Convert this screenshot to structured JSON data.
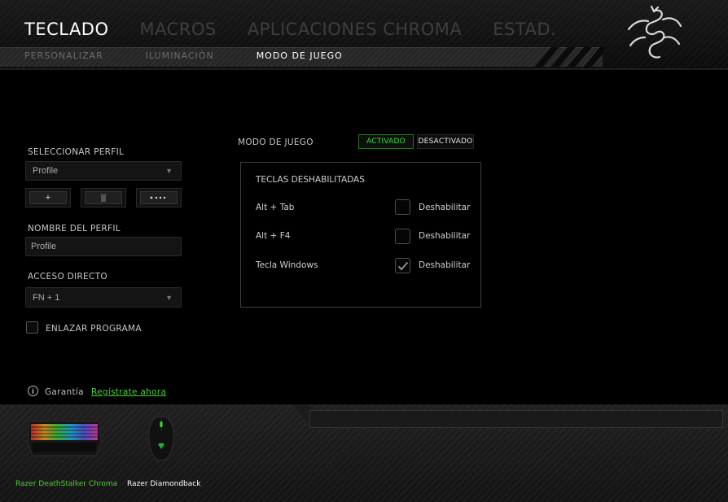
{
  "nav": {
    "main_tabs": [
      {
        "label": "TECLADO",
        "active": true
      },
      {
        "label": "MACROS",
        "active": false
      },
      {
        "label": "APLICACIONES CHROMA",
        "active": false
      },
      {
        "label": "ESTAD.",
        "active": false
      }
    ],
    "sub_tabs": [
      {
        "label": "PERSONALIZAR",
        "active": false
      },
      {
        "label": "ILUMINACIÓN",
        "active": false
      },
      {
        "label": "MODO DE JUEGO",
        "active": true
      }
    ]
  },
  "logo": {
    "icon": "razer-snake-logo"
  },
  "profile": {
    "select_label": "SELECCIONAR PERFIL",
    "select_value": "Profile",
    "add_icon": "+",
    "delete_icon": "trash-icon",
    "more_icon": "more-icon",
    "name_label": "NOMBRE DEL PERFIL",
    "name_value": "Profile",
    "shortcut_label": "ACCESO DIRECTO",
    "shortcut_value": "FN + 1",
    "link_program_label": "ENLAZAR PROGRAMA",
    "link_program_checked": false
  },
  "game_mode": {
    "label": "MODO DE JUEGO",
    "on_label": "ACTIVADO",
    "off_label": "DESACTIVADO",
    "active": "on",
    "panel_title": "TECLAS DESHABILITADAS",
    "rows": [
      {
        "key": "Alt + Tab",
        "action": "Deshabilitar",
        "checked": false
      },
      {
        "key": "Alt + F4",
        "action": "Deshabilitar",
        "checked": false
      },
      {
        "key": "Tecla Windows",
        "action": "Deshabilitar",
        "checked": true
      }
    ]
  },
  "warranty": {
    "icon": "info-icon",
    "label": "Garantía",
    "link": "Regístrate ahora"
  },
  "devices": [
    {
      "name": "Razer DeathStalker Chroma",
      "active": true
    },
    {
      "name": "Razer Diamondback",
      "active": false
    }
  ],
  "colors": {
    "accent": "#44d62c",
    "active_tab": "#ffffff",
    "inactive_tab": "#3e3e3e",
    "background": "#000000"
  }
}
